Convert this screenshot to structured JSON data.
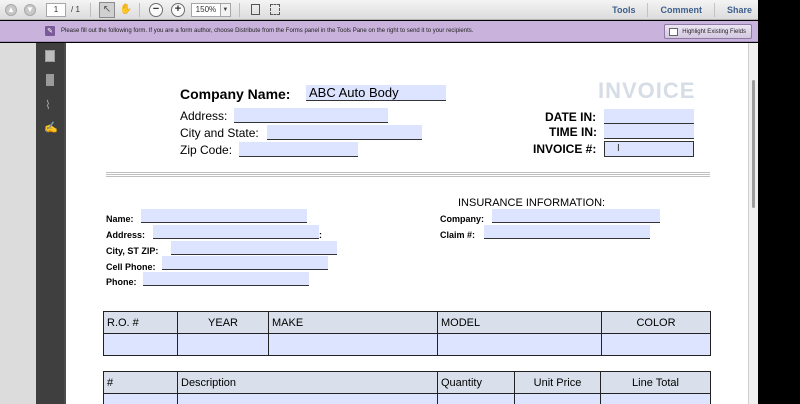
{
  "toolbar": {
    "page_current": "1",
    "page_total": "/  1",
    "zoom": "150%",
    "links": [
      "Tools",
      "Comment",
      "Share"
    ]
  },
  "notice": {
    "message": "Please fill out the following form. If you are a form author, choose Distribute from the Forms panel in the Tools Pane on the right to send it to your recipients.",
    "highlight_button": "Highlight Existing Fields"
  },
  "form": {
    "title": "INVOICE",
    "company_label": "Company Name:",
    "company_value": "ABC Auto Body",
    "address_label": "Address:",
    "city_state_label": "City and State:",
    "zip_label": "Zip Code:",
    "date_in_label": "DATE IN:",
    "time_in_label": "TIME IN:",
    "invoice_no_label": "INVOICE #:",
    "customer": {
      "name_label": "Name:",
      "address_label": "Address:",
      "colon_after_address": ":",
      "city_label": "City, ST ZIP:",
      "cell_label": "Cell Phone:",
      "phone_label": "Phone:"
    },
    "insurance": {
      "heading": "INSURANCE INFORMATION:",
      "company_label": "Company:",
      "claim_label": "Claim #:"
    },
    "vehicle_table": {
      "headers": [
        "R.O. #",
        "YEAR",
        "MAKE",
        "MODEL",
        "COLOR"
      ]
    },
    "items_table": {
      "headers": [
        "#",
        "Description",
        "Quantity",
        "Unit Price",
        "Line Total"
      ]
    }
  },
  "colors": {
    "notice_bg": "#c9b3dc",
    "field_fill": "#dde4ff",
    "header_fill": "#d9e0eb",
    "link": "#3d5f8c"
  }
}
